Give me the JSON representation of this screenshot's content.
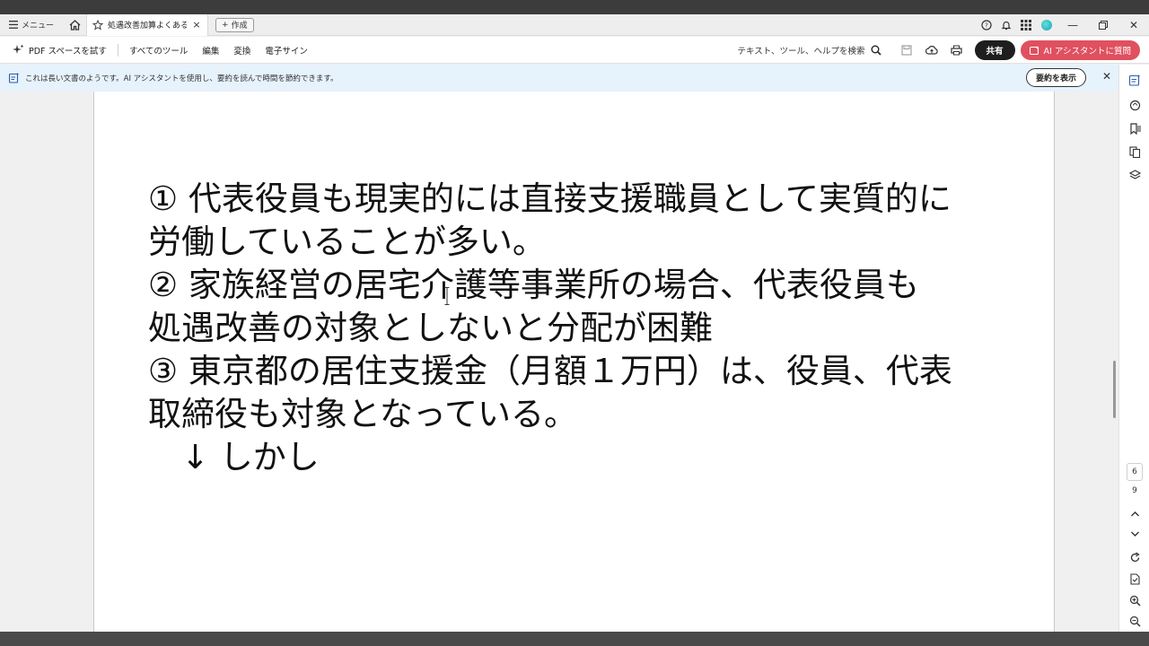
{
  "titlebar": {
    "menu_label": "メニュー",
    "tab_title": "処遇改善加算よくある...",
    "create_label": "作成"
  },
  "toolbar": {
    "try_pdf_space": "PDF スペースを試す",
    "all_tools": "すべてのツール",
    "edit": "編集",
    "convert": "変換",
    "e_sign": "電子サイン",
    "search_label": "テキスト、ツール、ヘルプを検索",
    "share": "共有",
    "ai_assistant": "AI アシスタントに質問"
  },
  "notice": {
    "text": "これは長い文書のようです。AI アシスタントを使用し、要約を読んで時間を節約できます。",
    "button": "要約を表示"
  },
  "document": {
    "lines": [
      "① 代表役員も現実的には直接支援職員として実質的に",
      "労働していることが多い。",
      "② 家族経営の居宅介護等事業所の場合、代表役員も",
      "処遇改善の対象としないと分配が困難",
      "③ 東京都の居住支援金（月額１万円）は、役員、代表",
      "取締役も対象となっている。",
      "　↓ しかし"
    ]
  },
  "pagination": {
    "current_page": "6",
    "total_pages": "9"
  },
  "colors": {
    "ai_button": "#e0505f",
    "share_button": "#1e1e1e",
    "notice_bar": "#e6f2fc"
  }
}
